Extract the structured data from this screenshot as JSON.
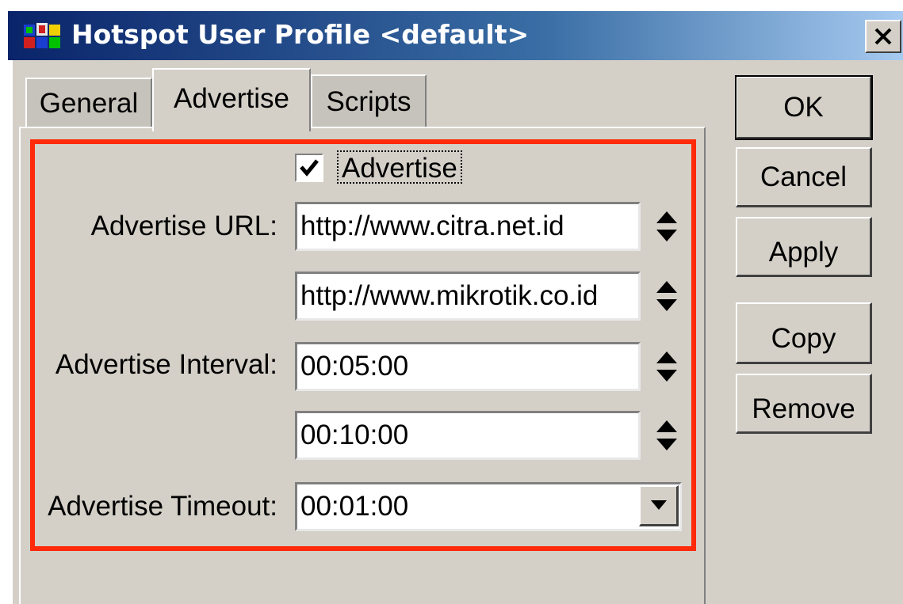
{
  "window": {
    "title": "Hotspot User Profile <default>",
    "app_icon": "winbox-icon",
    "close_label": "close-icon"
  },
  "tabs": [
    {
      "label": "General",
      "active": false
    },
    {
      "label": "Advertise",
      "active": true
    },
    {
      "label": "Scripts",
      "active": false
    }
  ],
  "form": {
    "advertise_checkbox": {
      "label": "Advertise",
      "checked": true
    },
    "advertise_url": {
      "label": "Advertise URL:",
      "values": [
        "http://www.citra.net.id",
        "http://www.mikrotik.co.id"
      ]
    },
    "advertise_interval": {
      "label": "Advertise Interval:",
      "values": [
        "00:05:00",
        "00:10:00"
      ]
    },
    "advertise_timeout": {
      "label": "Advertise Timeout:",
      "value": "00:01:00"
    }
  },
  "buttons": {
    "ok": "OK",
    "cancel": "Cancel",
    "apply": "Apply",
    "copy": "Copy",
    "remove": "Remove"
  },
  "colors": {
    "highlight_border": "#ff2a0a",
    "window_bg": "#d4d0c8",
    "title_gradient_start": "#0a246a"
  }
}
